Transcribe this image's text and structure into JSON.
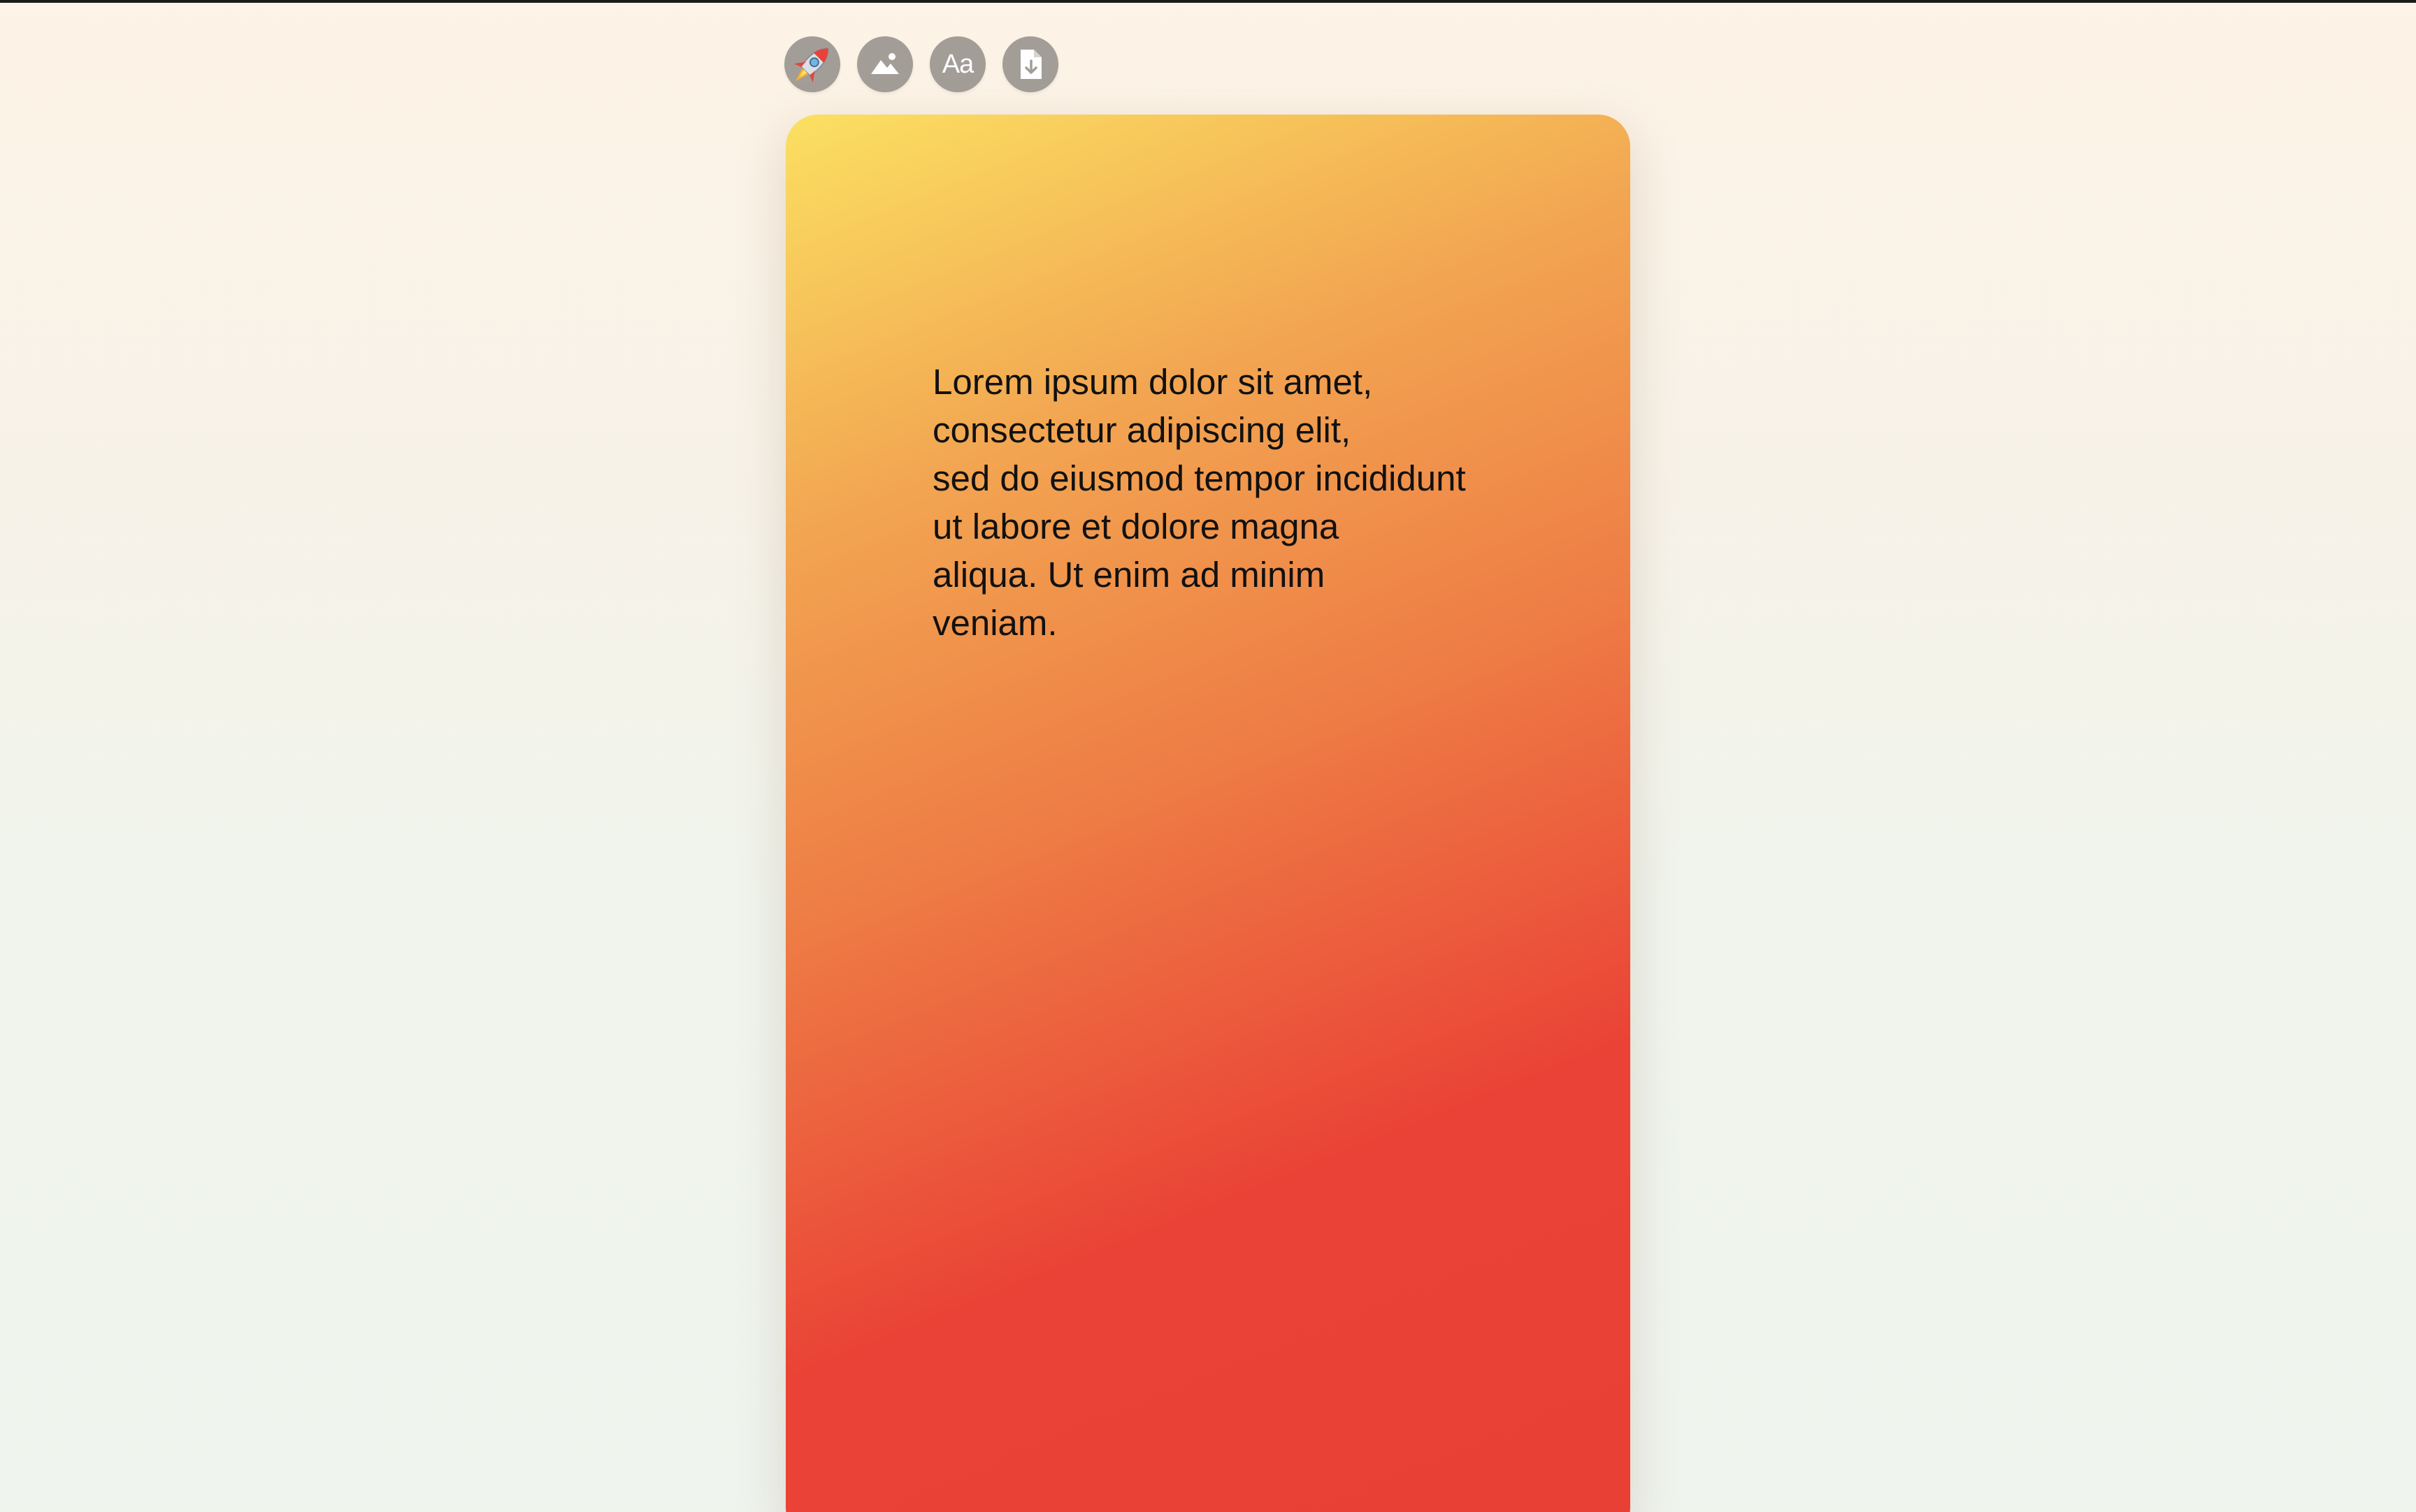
{
  "toolbar": {
    "buttons": [
      {
        "name": "rocket-icon",
        "kind": "emoji",
        "glyph": "🚀"
      },
      {
        "name": "image-icon",
        "kind": "icon"
      },
      {
        "name": "font-icon",
        "kind": "text",
        "label": "Aa"
      },
      {
        "name": "export-file-icon",
        "kind": "icon"
      }
    ]
  },
  "card": {
    "text": "Lorem ipsum dolor sit amet,\nconsectetur adipiscing elit,\nsed do eiusmod tempor incididunt\nut labore et dolore magna\naliqua. Ut enim ad minim\nveniam.",
    "gradient_colors": [
      "#fbe062",
      "#f2a551",
      "#ee7d45",
      "#ea4236"
    ]
  },
  "colors": {
    "button_bg": "#a39d98",
    "text": "#111111",
    "page_bg_top": "#fdf3e6",
    "page_bg_bottom": "#eff4ee"
  }
}
